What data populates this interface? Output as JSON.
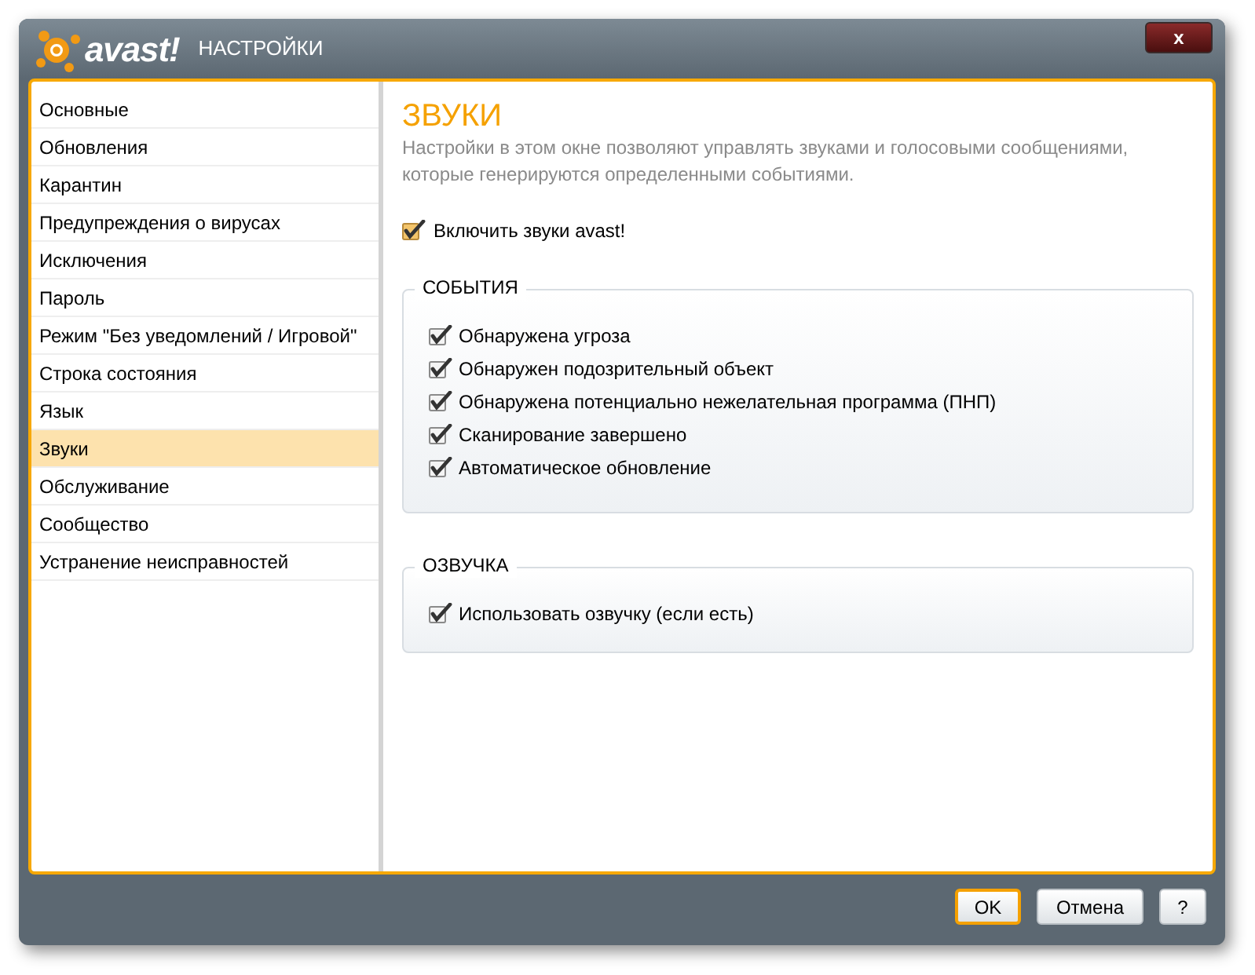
{
  "window": {
    "logo": "avast!",
    "title": "НАСТРОЙКИ",
    "close": "x"
  },
  "sidebar": {
    "items": [
      {
        "label": "Основные",
        "selected": false
      },
      {
        "label": "Обновления",
        "selected": false
      },
      {
        "label": "Карантин",
        "selected": false
      },
      {
        "label": "Предупреждения о вирусах",
        "selected": false
      },
      {
        "label": "Исключения",
        "selected": false
      },
      {
        "label": "Пароль",
        "selected": false
      },
      {
        "label": "Режим \"Без уведомлений / Игровой\"",
        "selected": false
      },
      {
        "label": "Строка состояния",
        "selected": false
      },
      {
        "label": "Язык",
        "selected": false
      },
      {
        "label": "Звуки",
        "selected": true
      },
      {
        "label": "Обслуживание",
        "selected": false
      },
      {
        "label": "Сообщество",
        "selected": false
      },
      {
        "label": "Устранение неисправностей",
        "selected": false
      }
    ]
  },
  "content": {
    "heading": "ЗВУКИ",
    "description": "Настройки в этом окне позволяют управлять звуками и голосовыми сообщениями, которые генерируются определенными событиями.",
    "main_option": {
      "label": "Включить звуки avast!",
      "checked": true
    },
    "groups": [
      {
        "title": "СОБЫТИЯ",
        "options": [
          {
            "label": "Обнаружена угроза",
            "checked": true
          },
          {
            "label": "Обнаружен подозрительный объект",
            "checked": true
          },
          {
            "label": "Обнаружена потенциально нежелательная программа (ПНП)",
            "checked": true
          },
          {
            "label": "Сканирование завершено",
            "checked": true
          },
          {
            "label": "Автоматическое обновление",
            "checked": true
          }
        ]
      },
      {
        "title": "ОЗВУЧКА",
        "options": [
          {
            "label": "Использовать озвучку (если есть)",
            "checked": true
          }
        ]
      }
    ]
  },
  "buttons": [
    {
      "label": "OK",
      "default": true
    },
    {
      "label": "Отмена",
      "default": false
    },
    {
      "label": "?",
      "default": false
    }
  ]
}
